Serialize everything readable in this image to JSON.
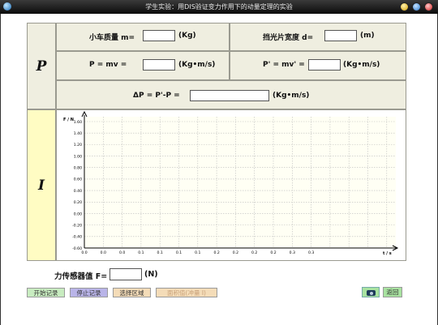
{
  "window": {
    "title": "学生实验：用DIS验证变力作用下的动量定理的实验"
  },
  "momentum": {
    "section_label": "P",
    "mass_label": "小车质量 m=",
    "mass_value": "",
    "mass_unit": "(Kg)",
    "width_label": "挡光片宽度 d=",
    "width_value": "",
    "width_unit": "(m)",
    "p_label": "P = mv =",
    "p_value": "",
    "p_unit": "(Kg•m/s)",
    "p2_label": "P' = mv' =",
    "p2_value": "",
    "p2_unit": "(Kg•m/s)",
    "dp_label": "ΔP = P'-P =",
    "dp_value": "",
    "dp_unit": "(Kg•m/s)"
  },
  "impulse": {
    "section_label": "I"
  },
  "chart_data": {
    "type": "line",
    "y_axis_label": "F / N",
    "x_axis_label": "t / s",
    "y_ticks": [
      "1.60",
      "1.40",
      "1.20",
      "1.00",
      "0.80",
      "0.60",
      "0.40",
      "0.20",
      "0.00",
      "-0.20",
      "-0.40",
      "-0.60"
    ],
    "x_ticks": [
      "0.0",
      "0.0",
      "0.0",
      "0.1",
      "0.1",
      "0.1",
      "0.1",
      "0.2",
      "0.2",
      "0.2",
      "0.2",
      "0.3",
      "0.3"
    ],
    "ylim": [
      -0.6,
      1.6
    ],
    "grid": true,
    "series": []
  },
  "sensor": {
    "label": "力传感器值 F=",
    "value": "",
    "unit": "(N)"
  },
  "toolbar": {
    "start_label": "开始记录",
    "stop_label": "停止记录",
    "select_label": "选择区域",
    "area_label": "面积值(冲量 I)",
    "back_label": "返回"
  },
  "colors": {
    "panel_bg": "#efeee0",
    "impulse_bg": "#fffcc3",
    "start_bg": "#c8ecc0",
    "stop_bg": "#b9b4e8",
    "select_bg": "#f4dcb8",
    "area_bg": "#f4dcb8",
    "back_bg": "#a8e2a0"
  }
}
